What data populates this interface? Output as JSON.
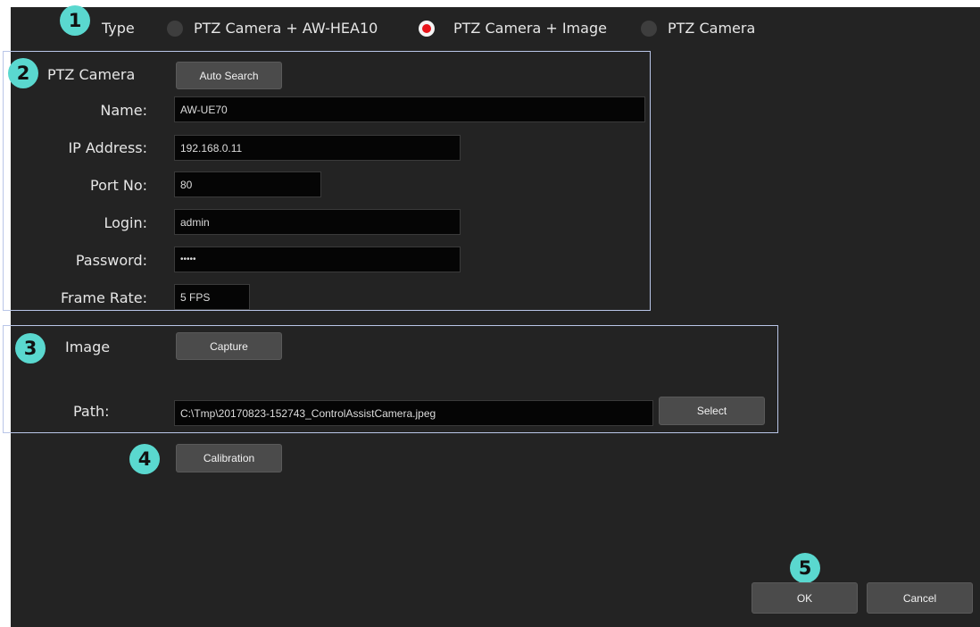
{
  "badges": [
    "1",
    "2",
    "3",
    "4",
    "5"
  ],
  "type": {
    "label": "Type",
    "options": [
      {
        "label": "PTZ Camera + AW-HEA10",
        "selected": false
      },
      {
        "label": "PTZ Camera + Image",
        "selected": true
      },
      {
        "label": "PTZ Camera",
        "selected": false
      }
    ]
  },
  "ptz": {
    "section_label": "PTZ Camera",
    "auto_search": "Auto Search",
    "name_label": "Name:",
    "name_value": "AW-UE70",
    "ip_label": "IP Address:",
    "ip_value": "192.168.0.11",
    "port_label": "Port No:",
    "port_value": "80",
    "login_label": "Login:",
    "login_value": "admin",
    "password_label": "Password:",
    "password_value": "•••••",
    "framerate_label": "Frame Rate:",
    "framerate_value": "5 FPS"
  },
  "image": {
    "section_label": "Image",
    "capture": "Capture",
    "path_label": "Path:",
    "path_value": "C:\\Tmp\\20170823-152743_ControlAssistCamera.jpeg",
    "select": "Select"
  },
  "calibration": "Calibration",
  "footer": {
    "ok": "OK",
    "cancel": "Cancel"
  },
  "colors": {
    "background": "#232323",
    "badge": "#5ad8cf",
    "radio_selected": "#e8141a",
    "group_border": "#b9c6e8"
  }
}
